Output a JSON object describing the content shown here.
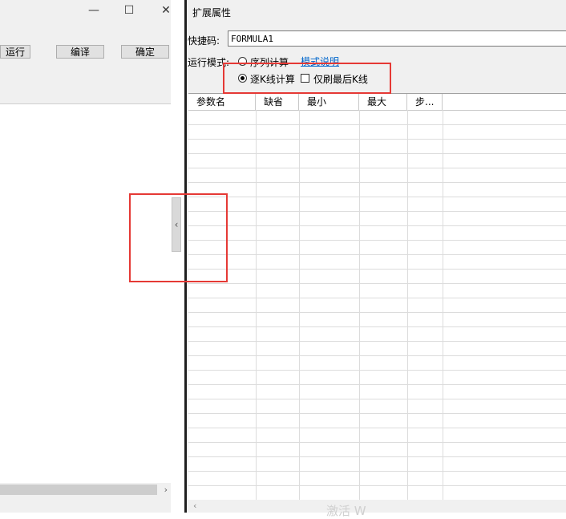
{
  "left_window": {
    "controls": {
      "minimize": "—",
      "maximize": "☐",
      "close": "✕"
    },
    "buttons": {
      "run": "运行",
      "compile": "编译",
      "ok": "确定"
    },
    "scroll_right_arrow": "›"
  },
  "splitter": {
    "collapse_arrow": "‹"
  },
  "right_panel": {
    "title": "扩展属性",
    "shortcut_label": "快捷码:",
    "shortcut_value": "FORMULA1",
    "mode_label": "运行模式:",
    "mode_options": [
      {
        "label": "序列计算",
        "selected": false
      },
      {
        "label": "逐K线计算",
        "selected": true
      }
    ],
    "mode_help_link": "模式说明",
    "refresh_last_only": {
      "label": "仅刷最后K线",
      "checked": false
    },
    "table": {
      "columns": [
        "参数名",
        "缺省",
        "最小",
        "最大",
        "步..."
      ],
      "rows": []
    },
    "scroll_left_arrow": "‹",
    "watermark": "激活 W"
  },
  "highlight_color": "#e53935"
}
